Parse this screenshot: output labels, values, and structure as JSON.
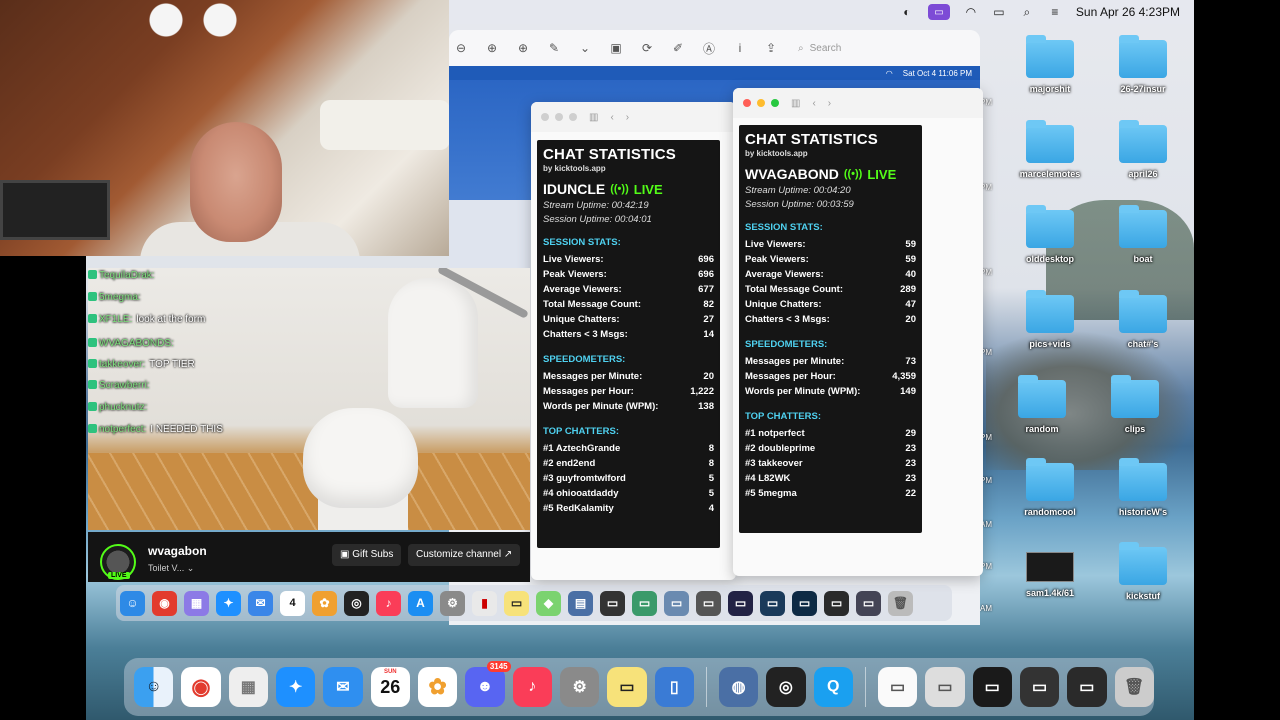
{
  "menubar": {
    "datetime": "Sun Apr 26  4:23PM",
    "icons": [
      "shield-icon",
      "screen-share-icon",
      "wifi-icon",
      "battery-icon",
      "search-icon",
      "control-center-icon"
    ]
  },
  "browser": {
    "search_placeholder": "Search",
    "inner_datetime": "Sat Oct 4  11:06 PM"
  },
  "stream": {
    "channel_name": "wvagabon",
    "category": "Toilet V...",
    "live_label": "LIVE",
    "gift_button": "Gift Subs",
    "customize_button": "Customize channel"
  },
  "chat": [
    {
      "user": "TequilaDrak:",
      "text": ""
    },
    {
      "user": "5megma:",
      "text": ""
    },
    {
      "user": "XF1LE:",
      "text": "look at the form"
    },
    {
      "user": "WVAGABONDS:",
      "text": ""
    },
    {
      "user": "takkeover:",
      "text": "TOP TIER"
    },
    {
      "user": "Scrawberri:",
      "text": ""
    },
    {
      "user": "phucknutz:",
      "text": ""
    },
    {
      "user": "notperfect:",
      "text": "I NEEDED THIS"
    }
  ],
  "stats_left": {
    "title": "CHAT STATISTICS",
    "by": "by kicktools.app",
    "streamer": "IDUNCLE",
    "live": "LIVE",
    "stream_uptime": "Stream Uptime: 00:42:19",
    "session_uptime": "Session Uptime: 00:04:01",
    "session_header": "SESSION STATS:",
    "session": [
      {
        "label": "Live Viewers:",
        "value": "696"
      },
      {
        "label": "Peak Viewers:",
        "value": "696"
      },
      {
        "label": "Average Viewers:",
        "value": "677"
      },
      {
        "label": "Total Message Count:",
        "value": "82"
      },
      {
        "label": "Unique Chatters:",
        "value": "27"
      },
      {
        "label": "Chatters < 3 Msgs:",
        "value": "14"
      }
    ],
    "speed_header": "SPEEDOMETERS:",
    "speed": [
      {
        "label": "Messages per Minute:",
        "value": "20"
      },
      {
        "label": "Messages per Hour:",
        "value": "1,222"
      },
      {
        "label": "Words per Minute (WPM):",
        "value": "138"
      }
    ],
    "top_header": "TOP CHATTERS:",
    "top": [
      {
        "label": "#1  AztechGrande",
        "value": "8"
      },
      {
        "label": "#2  end2end",
        "value": "8"
      },
      {
        "label": "#3  guyfromtwlford",
        "value": "5"
      },
      {
        "label": "#4  ohiooatdaddy",
        "value": "5"
      },
      {
        "label": "#5  RedKalamity",
        "value": "4"
      }
    ]
  },
  "stats_right": {
    "title": "CHAT STATISTICS",
    "by": "by kicktools.app",
    "streamer": "WVAGABOND",
    "live": "LIVE",
    "stream_uptime": "Stream Uptime: 00:04:20",
    "session_uptime": "Session Uptime: 00:03:59",
    "session_header": "SESSION STATS:",
    "session": [
      {
        "label": "Live Viewers:",
        "value": "59"
      },
      {
        "label": "Peak Viewers:",
        "value": "59"
      },
      {
        "label": "Average Viewers:",
        "value": "40"
      },
      {
        "label": "Total Message Count:",
        "value": "289"
      },
      {
        "label": "Unique Chatters:",
        "value": "47"
      },
      {
        "label": "Chatters < 3 Msgs:",
        "value": "20"
      }
    ],
    "speed_header": "SPEEDOMETERS:",
    "speed": [
      {
        "label": "Messages per Minute:",
        "value": "73"
      },
      {
        "label": "Messages per Hour:",
        "value": "4,359"
      },
      {
        "label": "Words per Minute (WPM):",
        "value": "149"
      }
    ],
    "top_header": "TOP CHATTERS:",
    "top": [
      {
        "label": "#1  notperfect",
        "value": "29"
      },
      {
        "label": "#2  doubleprime",
        "value": "23"
      },
      {
        "label": "#3  takkeover",
        "value": "23"
      },
      {
        "label": "#4  L82WK",
        "value": "23"
      },
      {
        "label": "#5  5megma",
        "value": "22"
      }
    ]
  },
  "desktop_icons": [
    {
      "label": "majorshit"
    },
    {
      "label": "26-27insur"
    },
    {
      "label": "marcelemotes"
    },
    {
      "label": "april26"
    },
    {
      "label": "olddesktop"
    },
    {
      "label": "boat"
    },
    {
      "label": "pics+vids"
    },
    {
      "label": "chat#'s"
    },
    {
      "label": "random"
    },
    {
      "label": "clips"
    },
    {
      "label": "randomcool"
    },
    {
      "label": "historicW's"
    },
    {
      "label": "sam1.4k/61"
    },
    {
      "label": "kickstuf"
    }
  ],
  "dock": {
    "calendar_day": "26",
    "calendar_month": "SUN",
    "app_calendar_day": "4",
    "discord_badge": "3145"
  },
  "side_times": [
    "PM",
    "PM",
    "PM",
    "PM",
    "PM",
    "PM",
    "AM",
    "PM",
    "AM"
  ]
}
